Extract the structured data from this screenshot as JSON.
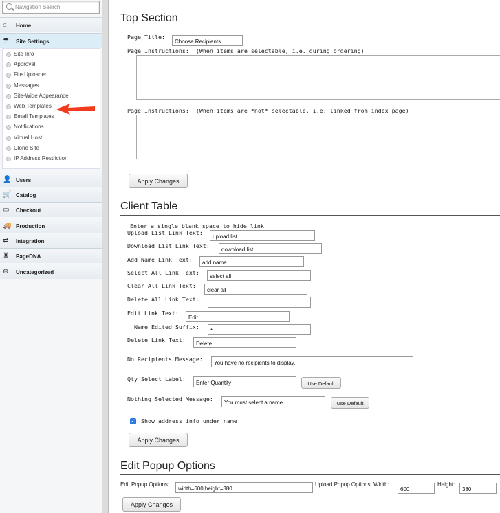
{
  "sidebar": {
    "search_placeholder": "Navigation Search",
    "home": "Home",
    "site_settings": "Site Settings",
    "sub_items": [
      "Site Info",
      "Approval",
      "File Uploader",
      "Messages",
      "Site-Wide Appearance",
      "Web Templates",
      "Email Templates",
      "Notifications",
      "Virtual Host",
      "Clone Site",
      "IP Address Restriction"
    ],
    "sections": [
      "Users",
      "Catalog",
      "Checkout",
      "Production",
      "Integration",
      "PageDNA",
      "Uncategorized"
    ]
  },
  "top_section": {
    "heading": "Top Section",
    "page_title_label": "Page Title:",
    "page_title_value": "Choose Recipients",
    "instr1_label": "Page Instructions:  (When items are selectable, i.e. during ordering)",
    "instr2_label": "Page Instructions:  (When items are *not* selectable, i.e. linked from index page)",
    "apply": "Apply Changes"
  },
  "client_table": {
    "heading": "Client Table",
    "hint": "Enter a single blank space to hide link",
    "fields": [
      {
        "label": "Upload List Link Text:",
        "value": "upload list"
      },
      {
        "label": "Download List Link Text:",
        "value": "download list"
      },
      {
        "label": "Add Name Link Text:",
        "value": "add name"
      },
      {
        "label": "Select All Link Text:",
        "value": "select all"
      },
      {
        "label": "Clear All Link Text:",
        "value": "clear all"
      },
      {
        "label": "Delete All Link Text:",
        "value": ""
      },
      {
        "label": "Edit Link Text:",
        "value": "Edit"
      },
      {
        "label": "Name Edited Suffix:",
        "value": "*"
      },
      {
        "label": "Delete Link Text:",
        "value": "Delete"
      }
    ],
    "no_recipients_label": "No Recipients Message:",
    "no_recipients_value": "You have no recipients to display.",
    "qty_label": "Qty Select Label:",
    "qty_value": "Enter Quantity",
    "nothing_label": "Nothing Selected Message:",
    "nothing_value": "You must select a name.",
    "use_default": "Use Default",
    "show_address_label": "Show address info under name",
    "show_address_checked": true,
    "apply": "Apply Changes"
  },
  "popup": {
    "heading": "Edit Popup Options",
    "edit_label": "Edit Popup Options:",
    "edit_value": "width=600,height=380",
    "upload_width_label": "Upload Popup Options: Width:",
    "upload_width_value": "600",
    "height_label": "Height:",
    "height_value": "380",
    "apply": "Apply Changes"
  }
}
